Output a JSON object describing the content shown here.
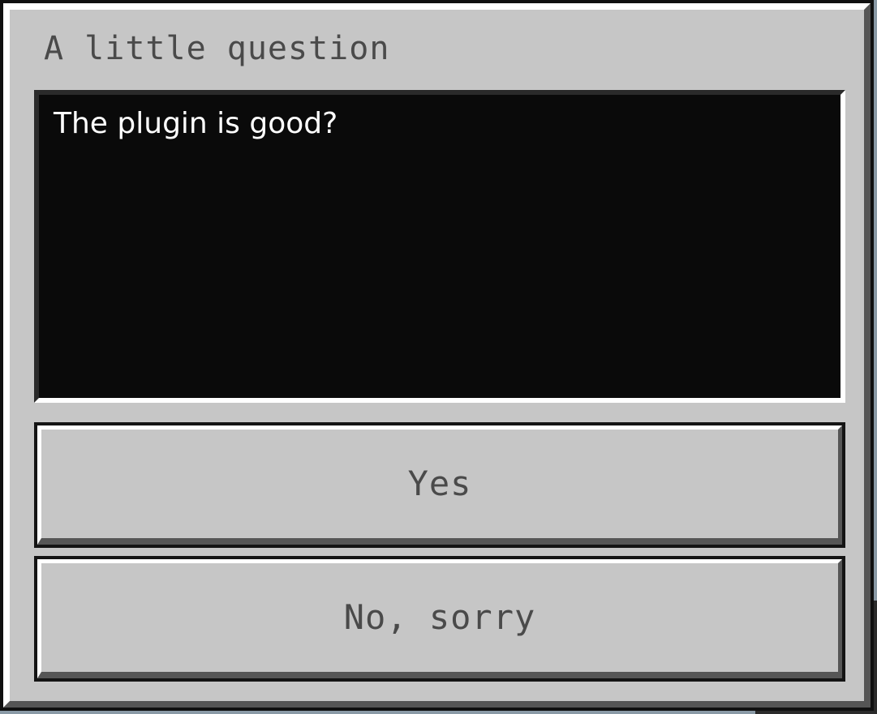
{
  "dialog": {
    "title": "A little question",
    "content": "The plugin is good?",
    "buttons": [
      {
        "label": "Yes"
      },
      {
        "label": "No, sorry"
      }
    ]
  },
  "colors": {
    "panel": "#c6c6c6",
    "content_bg": "#0a0a0a",
    "text_dark": "#4a4a4a",
    "text_light": "#ffffff"
  }
}
